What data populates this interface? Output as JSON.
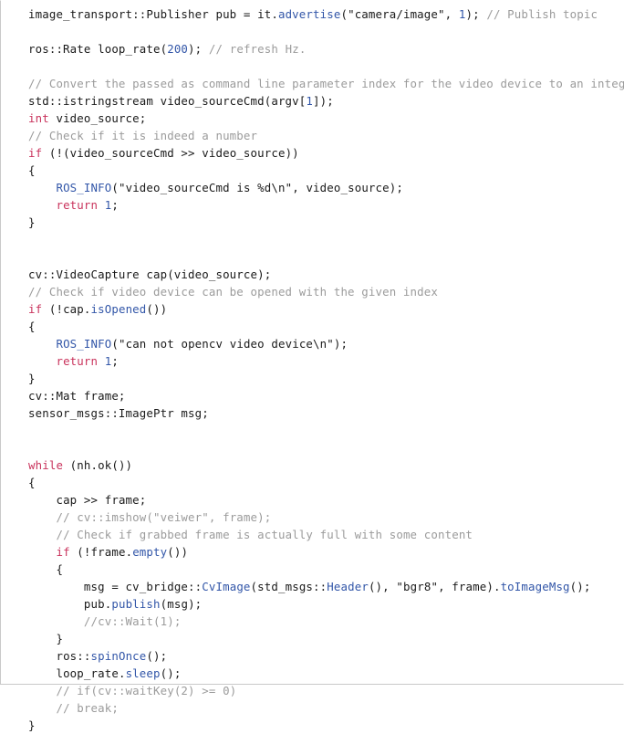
{
  "colors": {
    "background": "#ffffff",
    "text": "#1a1a1a",
    "keyword": "#c9335c",
    "function": "#3256a8",
    "number": "#3256a8",
    "string": "#1a1a1a",
    "comment": "#9b9b9b",
    "border": "#c9c9c9"
  },
  "code": {
    "language": "cpp",
    "lines": [
      {
        "id": "line-1",
        "indent": 0,
        "tokens": [
          {
            "t": "image_transport::Publisher pub = it.",
            "c": "plain"
          },
          {
            "t": "advertise",
            "c": "fn"
          },
          {
            "t": "(",
            "c": "plain"
          },
          {
            "t": "\"camera/image\"",
            "c": "str"
          },
          {
            "t": ", ",
            "c": "plain"
          },
          {
            "t": "1",
            "c": "num"
          },
          {
            "t": "); ",
            "c": "plain"
          },
          {
            "t": "// Publish topic",
            "c": "comment"
          }
        ]
      },
      {
        "id": "line-2",
        "indent": 0,
        "tokens": []
      },
      {
        "id": "line-3",
        "indent": 0,
        "tokens": [
          {
            "t": "ros::Rate loop_rate(",
            "c": "plain"
          },
          {
            "t": "200",
            "c": "num"
          },
          {
            "t": "); ",
            "c": "plain"
          },
          {
            "t": "// refresh Hz.",
            "c": "comment"
          }
        ]
      },
      {
        "id": "line-4",
        "indent": 0,
        "tokens": []
      },
      {
        "id": "line-5",
        "indent": 0,
        "tokens": [
          {
            "t": "// Convert the passed as command line parameter index for the video device to an integer",
            "c": "comment"
          }
        ]
      },
      {
        "id": "line-6",
        "indent": 0,
        "tokens": [
          {
            "t": "std::istringstream video_sourceCmd(argv[",
            "c": "plain"
          },
          {
            "t": "1",
            "c": "num"
          },
          {
            "t": "]);",
            "c": "plain"
          }
        ]
      },
      {
        "id": "line-7",
        "indent": 0,
        "tokens": [
          {
            "t": "int",
            "c": "kw"
          },
          {
            "t": " video_source;",
            "c": "plain"
          }
        ]
      },
      {
        "id": "line-8",
        "indent": 0,
        "tokens": [
          {
            "t": "// Check if it is indeed a number",
            "c": "comment"
          }
        ]
      },
      {
        "id": "line-9",
        "indent": 0,
        "tokens": [
          {
            "t": "if",
            "c": "kw"
          },
          {
            "t": " (!(video_sourceCmd >> video_source))",
            "c": "plain"
          }
        ]
      },
      {
        "id": "line-10",
        "indent": 0,
        "tokens": [
          {
            "t": "{",
            "c": "plain"
          }
        ]
      },
      {
        "id": "line-11",
        "indent": 1,
        "tokens": [
          {
            "t": "ROS_INFO",
            "c": "fn"
          },
          {
            "t": "(",
            "c": "plain"
          },
          {
            "t": "\"video_sourceCmd is %d\\n\"",
            "c": "str"
          },
          {
            "t": ", video_source);",
            "c": "plain"
          }
        ]
      },
      {
        "id": "line-12",
        "indent": 1,
        "tokens": [
          {
            "t": "return",
            "c": "kw"
          },
          {
            "t": " ",
            "c": "plain"
          },
          {
            "t": "1",
            "c": "num"
          },
          {
            "t": ";",
            "c": "plain"
          }
        ]
      },
      {
        "id": "line-13",
        "indent": 0,
        "tokens": [
          {
            "t": "}",
            "c": "plain"
          }
        ]
      },
      {
        "id": "line-14",
        "indent": 0,
        "tokens": []
      },
      {
        "id": "line-15",
        "indent": 0,
        "tokens": []
      },
      {
        "id": "line-16",
        "indent": 0,
        "tokens": [
          {
            "t": "cv::VideoCapture cap(video_source);",
            "c": "plain"
          }
        ]
      },
      {
        "id": "line-17",
        "indent": 0,
        "tokens": [
          {
            "t": "// Check if video device can be opened with the given index",
            "c": "comment"
          }
        ]
      },
      {
        "id": "line-18",
        "indent": 0,
        "tokens": [
          {
            "t": "if",
            "c": "kw"
          },
          {
            "t": " (!cap.",
            "c": "plain"
          },
          {
            "t": "isOpened",
            "c": "fn"
          },
          {
            "t": "())",
            "c": "plain"
          }
        ]
      },
      {
        "id": "line-19",
        "indent": 0,
        "tokens": [
          {
            "t": "{",
            "c": "plain"
          }
        ]
      },
      {
        "id": "line-20",
        "indent": 1,
        "tokens": [
          {
            "t": "ROS_INFO",
            "c": "fn"
          },
          {
            "t": "(",
            "c": "plain"
          },
          {
            "t": "\"can not opencv video device\\n\"",
            "c": "str"
          },
          {
            "t": ");",
            "c": "plain"
          }
        ]
      },
      {
        "id": "line-21",
        "indent": 1,
        "tokens": [
          {
            "t": "return",
            "c": "kw"
          },
          {
            "t": " ",
            "c": "plain"
          },
          {
            "t": "1",
            "c": "num"
          },
          {
            "t": ";",
            "c": "plain"
          }
        ]
      },
      {
        "id": "line-22",
        "indent": 0,
        "tokens": [
          {
            "t": "}",
            "c": "plain"
          }
        ]
      },
      {
        "id": "line-23",
        "indent": 0,
        "tokens": [
          {
            "t": "cv::Mat frame;",
            "c": "plain"
          }
        ]
      },
      {
        "id": "line-24",
        "indent": 0,
        "tokens": [
          {
            "t": "sensor_msgs::ImagePtr msg;",
            "c": "plain"
          }
        ]
      },
      {
        "id": "line-25",
        "indent": 0,
        "tokens": []
      },
      {
        "id": "line-26",
        "indent": 0,
        "tokens": []
      },
      {
        "id": "line-27",
        "indent": 0,
        "tokens": [
          {
            "t": "while",
            "c": "kw"
          },
          {
            "t": " (nh.ok())",
            "c": "plain"
          }
        ]
      },
      {
        "id": "line-28",
        "indent": 0,
        "tokens": [
          {
            "t": "{",
            "c": "plain"
          }
        ]
      },
      {
        "id": "line-29",
        "indent": 1,
        "tokens": [
          {
            "t": "cap >> frame;",
            "c": "plain"
          }
        ]
      },
      {
        "id": "line-30",
        "indent": 1,
        "tokens": [
          {
            "t": "// cv::imshow(\"veiwer\", frame);",
            "c": "comment"
          }
        ]
      },
      {
        "id": "line-31",
        "indent": 1,
        "tokens": [
          {
            "t": "// Check if grabbed frame is actually full with some content",
            "c": "comment"
          }
        ]
      },
      {
        "id": "line-32",
        "indent": 1,
        "tokens": [
          {
            "t": "if",
            "c": "kw"
          },
          {
            "t": " (!frame.",
            "c": "plain"
          },
          {
            "t": "empty",
            "c": "fn"
          },
          {
            "t": "())",
            "c": "plain"
          }
        ]
      },
      {
        "id": "line-33",
        "indent": 1,
        "tokens": [
          {
            "t": "{",
            "c": "plain"
          }
        ]
      },
      {
        "id": "line-34",
        "indent": 2,
        "tokens": [
          {
            "t": "msg = cv_bridge::",
            "c": "plain"
          },
          {
            "t": "CvImage",
            "c": "fn"
          },
          {
            "t": "(std_msgs::",
            "c": "plain"
          },
          {
            "t": "Header",
            "c": "fn"
          },
          {
            "t": "(), ",
            "c": "plain"
          },
          {
            "t": "\"bgr8\"",
            "c": "str"
          },
          {
            "t": ", frame).",
            "c": "plain"
          },
          {
            "t": "toImageMsg",
            "c": "fn"
          },
          {
            "t": "();",
            "c": "plain"
          }
        ]
      },
      {
        "id": "line-35",
        "indent": 2,
        "tokens": [
          {
            "t": "pub.",
            "c": "plain"
          },
          {
            "t": "publish",
            "c": "fn"
          },
          {
            "t": "(msg);",
            "c": "plain"
          }
        ]
      },
      {
        "id": "line-36",
        "indent": 2,
        "tokens": [
          {
            "t": "//cv::Wait(1);",
            "c": "comment"
          }
        ]
      },
      {
        "id": "line-37",
        "indent": 1,
        "tokens": [
          {
            "t": "}",
            "c": "plain"
          }
        ]
      },
      {
        "id": "line-38",
        "indent": 1,
        "tokens": [
          {
            "t": "ros::",
            "c": "plain"
          },
          {
            "t": "spinOnce",
            "c": "fn"
          },
          {
            "t": "();",
            "c": "plain"
          }
        ]
      },
      {
        "id": "line-39",
        "indent": 1,
        "tokens": [
          {
            "t": "loop_rate.",
            "c": "plain"
          },
          {
            "t": "sleep",
            "c": "fn"
          },
          {
            "t": "();",
            "c": "plain"
          }
        ]
      },
      {
        "id": "line-40",
        "indent": 1,
        "tokens": [
          {
            "t": "// if(cv::waitKey(2) >= 0)",
            "c": "comment"
          }
        ]
      },
      {
        "id": "line-41",
        "indent": 1,
        "tokens": [
          {
            "t": "// break;",
            "c": "comment"
          }
        ]
      },
      {
        "id": "line-42",
        "indent": 0,
        "tokens": [
          {
            "t": "}",
            "c": "plain"
          }
        ]
      }
    ]
  }
}
